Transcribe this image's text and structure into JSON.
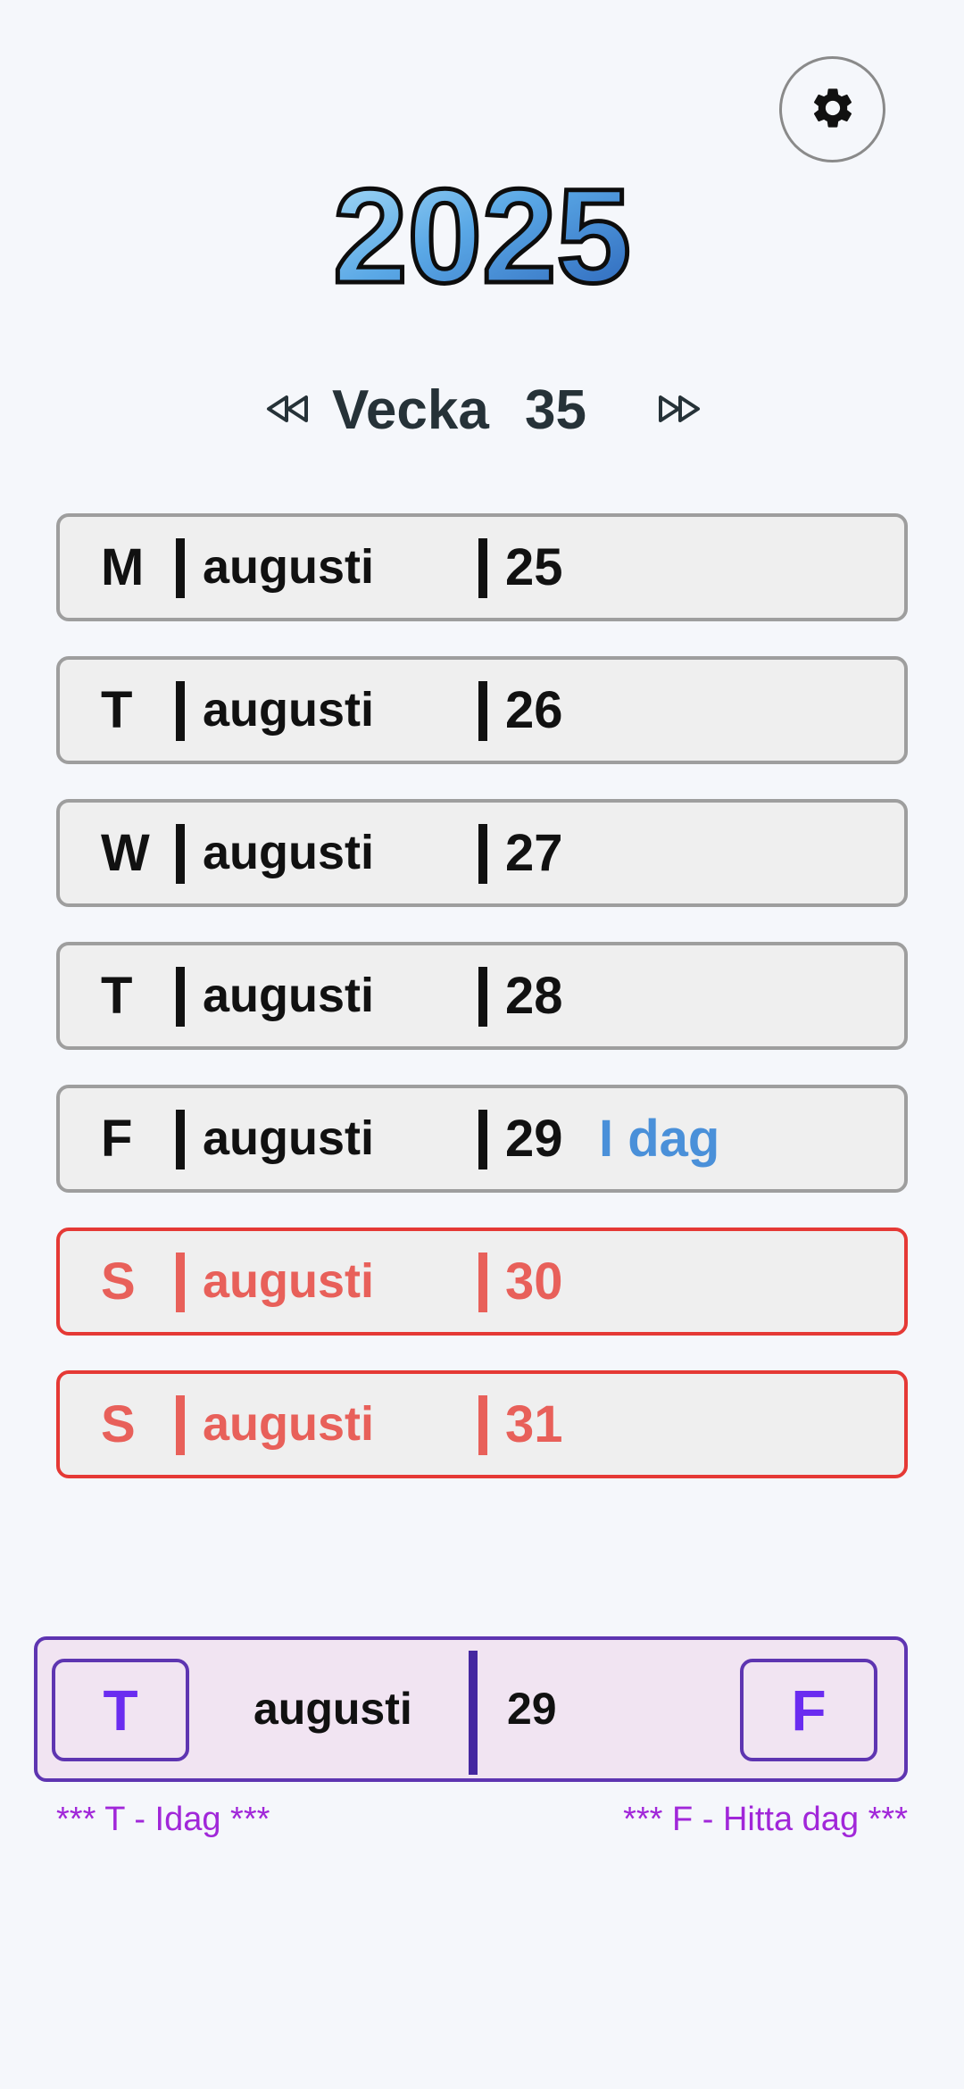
{
  "header": {
    "year": "2025",
    "settings_icon": "gear-icon"
  },
  "week_nav": {
    "prev_icon": "rewind-icon",
    "label": "Vecka",
    "number": "35",
    "next_icon": "fast-forward-icon"
  },
  "days": [
    {
      "letter": "M",
      "month": "augusti",
      "day": "25",
      "weekend": false,
      "today_label": ""
    },
    {
      "letter": "T",
      "month": "augusti",
      "day": "26",
      "weekend": false,
      "today_label": ""
    },
    {
      "letter": "W",
      "month": "augusti",
      "day": "27",
      "weekend": false,
      "today_label": ""
    },
    {
      "letter": "T",
      "month": "augusti",
      "day": "28",
      "weekend": false,
      "today_label": ""
    },
    {
      "letter": "F",
      "month": "augusti",
      "day": "29",
      "weekend": false,
      "today_label": "I dag"
    },
    {
      "letter": "S",
      "month": "augusti",
      "day": "30",
      "weekend": true,
      "today_label": ""
    },
    {
      "letter": "S",
      "month": "augusti",
      "day": "31",
      "weekend": true,
      "today_label": ""
    }
  ],
  "finder": {
    "today_button": "T",
    "month": "augusti",
    "day": "29",
    "find_button": "F"
  },
  "hints": {
    "left": "*** T - Idag ***",
    "right": "*** F - Hitta dag ***"
  },
  "colors": {
    "background": "#f5f7fb",
    "weekend": "#e8605a",
    "today": "#4a90d9",
    "accent": "#5e35b1",
    "hint": "#a127d9"
  }
}
